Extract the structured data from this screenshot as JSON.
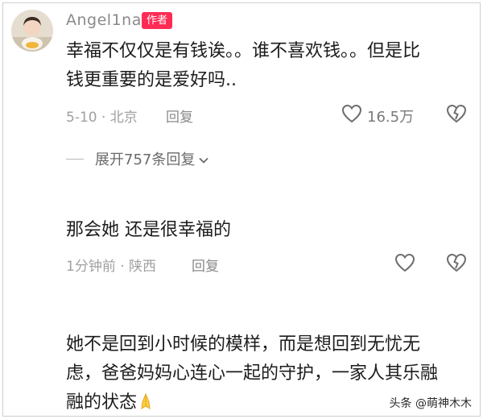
{
  "comments": [
    {
      "username": "Angel1na",
      "badge": "作者",
      "lines": [
        "幸福不仅仅是有钱诶。。谁不喜欢钱。。但是比",
        "钱更重要的是爱好吗.."
      ],
      "meta": "5-10 · 北京",
      "reply": "回复",
      "likes": "16.5万",
      "expand": "展开757条回复"
    },
    {
      "lines": [
        "那会她 还是很幸福的"
      ],
      "meta": "1分钟前 · 陕西",
      "reply": "回复"
    },
    {
      "lines": [
        "她不是回到小时候的模样，而是想回到无忧无",
        "虑，爸爸妈妈心连心一起的守护，一家人其乐融",
        "融的状态"
      ]
    }
  ],
  "watermark": "头条 @萌神木木",
  "colors": {
    "badge": "#fe2c55",
    "meta": "#a0a0a0",
    "text": "#1c1c1c"
  },
  "icons": [
    "avatar",
    "heart-icon",
    "broken-heart-icon",
    "chevron-down-icon",
    "praying-hands-emoji"
  ]
}
